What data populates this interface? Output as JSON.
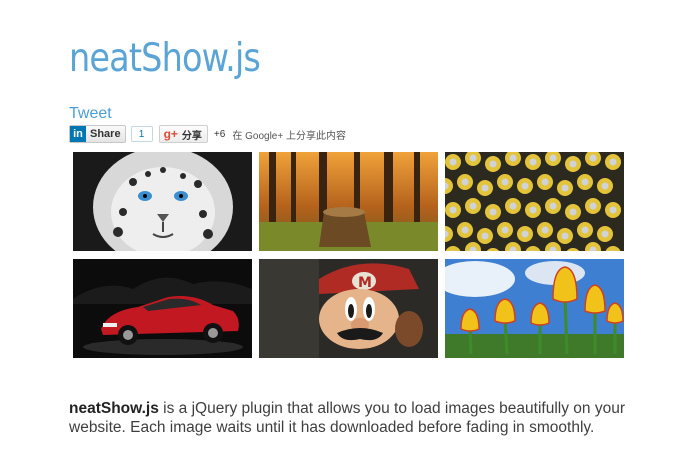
{
  "page": {
    "title": "neatShow.js",
    "tweet_label": "Tweet"
  },
  "share": {
    "linkedin_label": "Share",
    "linkedin_count": "1",
    "gplus_label": "分享",
    "gplus_count": "+6",
    "gplus_note": "在 Google+ 上分享此内容"
  },
  "gallery": {
    "images": [
      {
        "subject": "snow leopard"
      },
      {
        "subject": "forest stump"
      },
      {
        "subject": "minions crowd"
      },
      {
        "subject": "red sports car"
      },
      {
        "subject": "mario"
      },
      {
        "subject": "tulips"
      }
    ]
  },
  "description": {
    "name": "neatShow.js",
    "text": " is a jQuery plugin that allows you to load images beautifully on your website. Each image waits until it has downloaded before fading in smoothly."
  },
  "colors": {
    "title": "#5ba5d6",
    "link": "#4a9fd8",
    "linkedin": "#0077b5",
    "gplus": "#dd4b39"
  }
}
